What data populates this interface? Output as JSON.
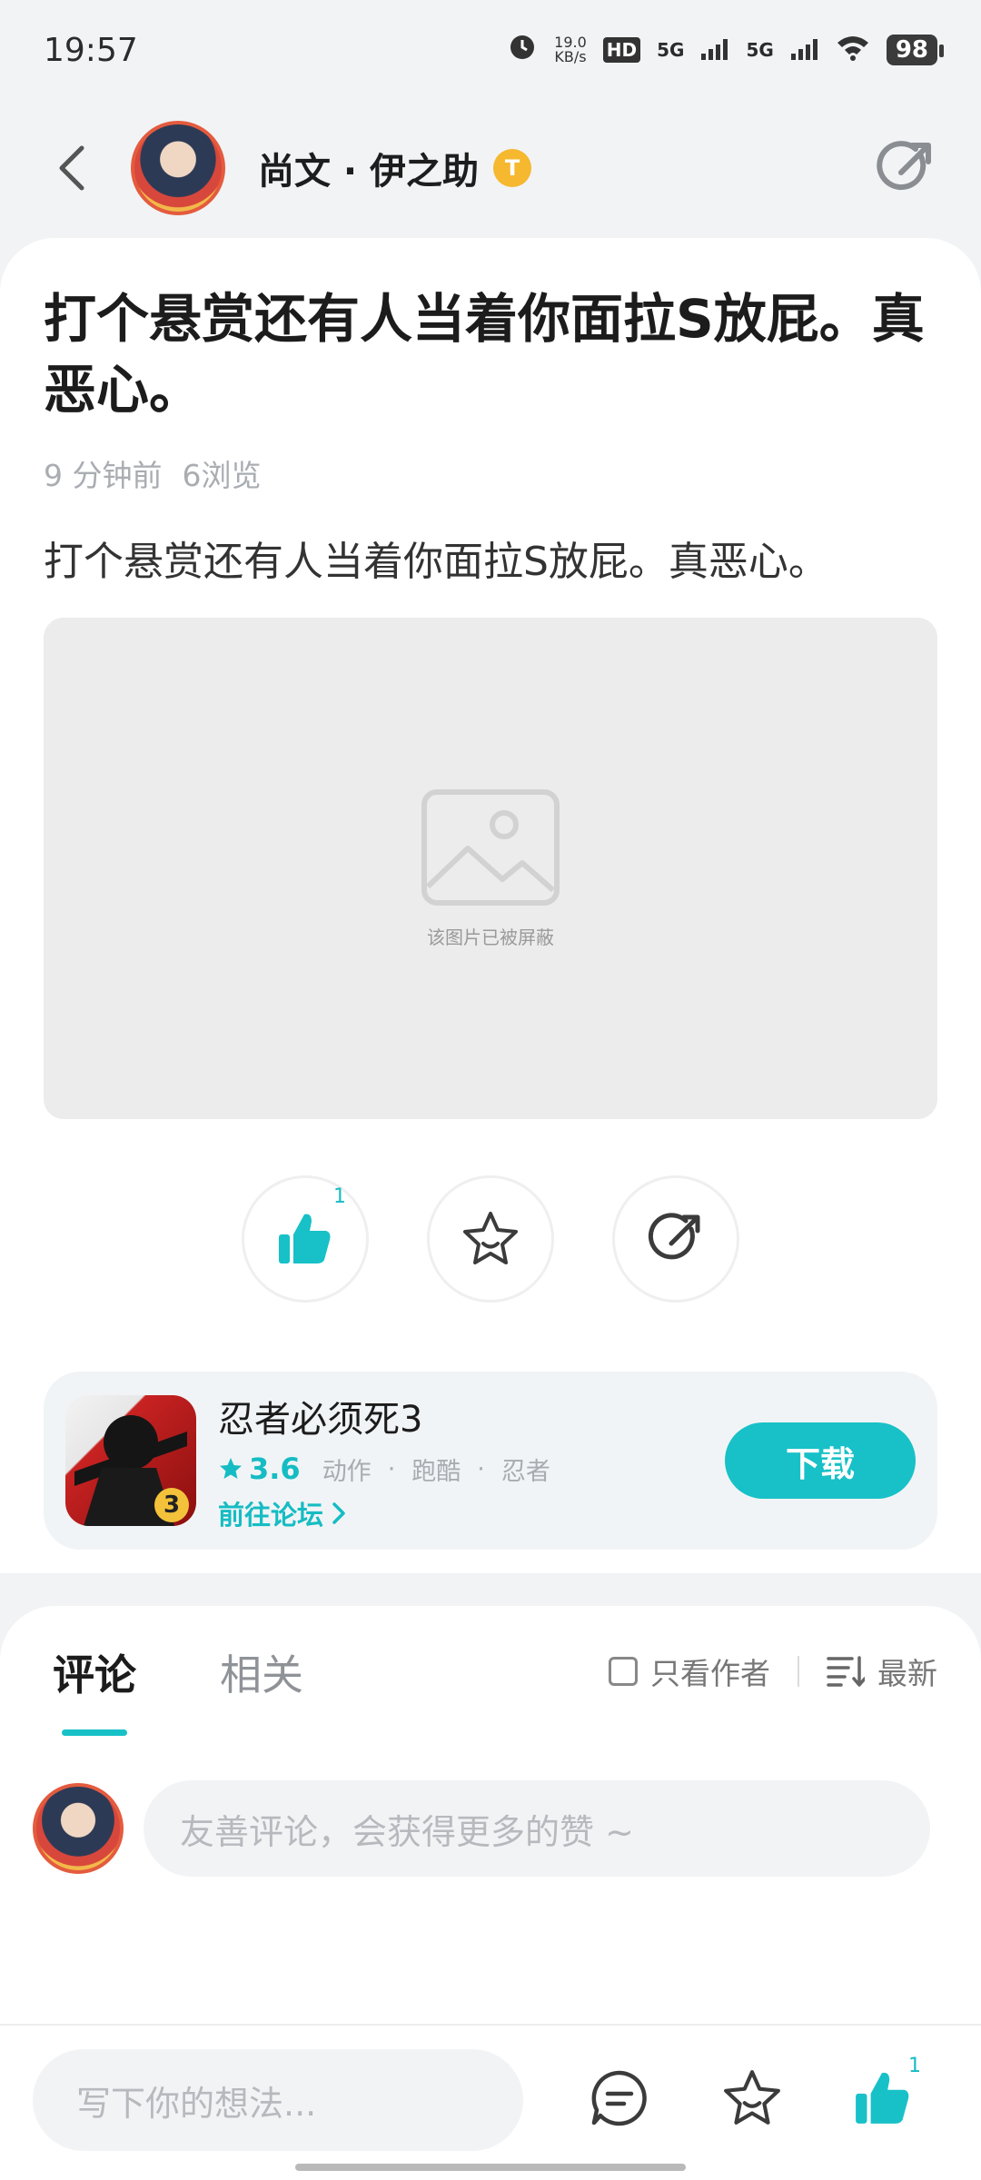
{
  "status_bar": {
    "time": "19:57",
    "net_speed_value": "19.0",
    "net_speed_unit": "KB/s",
    "hd_label": "HD",
    "signal1": "5G",
    "signal2": "5G",
    "battery": "98",
    "icons": [
      "alarm-icon",
      "wifi-icon",
      "battery-icon"
    ]
  },
  "header": {
    "author_name": "尚文 · 伊之助",
    "badge": "T"
  },
  "post": {
    "title": "打个悬赏还有人当着你面拉S放屁。真恶心。",
    "time_ago": "9 分钟前",
    "views": "6浏览",
    "body": "打个悬赏还有人当着你面拉S放屁。真恶心。",
    "image_blocked_text": "该图片已被屏蔽"
  },
  "actions": {
    "like_count": "1",
    "icons": [
      "thumbs-up-icon",
      "star-icon",
      "share-icon"
    ]
  },
  "game": {
    "name": "忍者必须死3",
    "rating": "3.6",
    "tags": [
      "动作",
      "跑酷",
      "忍者"
    ],
    "forum_link": "前往论坛",
    "download_label": "下载",
    "icon_number": "3"
  },
  "comments": {
    "tab_comments": "评论",
    "tab_related": "相关",
    "only_author": "只看作者",
    "sort_label": "最新",
    "input_placeholder": "友善评论，会获得更多的赞 ~"
  },
  "bottom_bar": {
    "input_placeholder": "写下你的想法...",
    "like_count": "1"
  },
  "colors": {
    "accent": "#17c1c7",
    "badge": "#f5b82e",
    "background": "#f1f3f5"
  }
}
